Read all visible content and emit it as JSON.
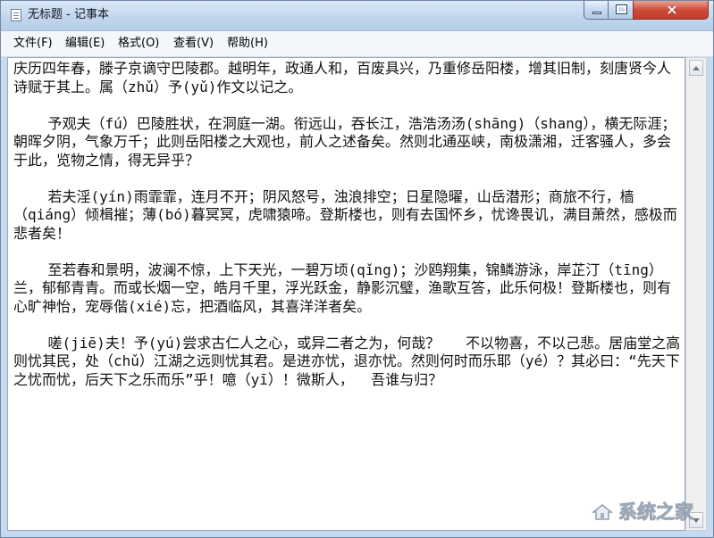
{
  "window": {
    "title": "无标题 - 记事本"
  },
  "menu": {
    "items": [
      "文件(F)",
      "编辑(E)",
      "格式(O)",
      "查看(V)",
      "帮助(H)"
    ]
  },
  "document": {
    "content": "庆历四年春，滕子京谪守巴陵郡。越明年，政通人和，百废具兴，乃重修岳阳楼，增其旧制，刻唐贤今人诗赋于其上。属（zhǔ）予(yǔ)作文以记之。\n\n    予观夫（fú）巴陵胜状，在洞庭一湖。衔远山，吞长江，浩浩汤汤(shāng)（shang），横无际涯；朝晖夕阴，气象万千；此则岳阳楼之大观也，前人之述备矣。然则北通巫峡，南极潇湘，迁客骚人，多会于此，览物之情，得无异乎？\n\n    若夫淫(yín)雨霏霏，连月不开；阴风怒号，浊浪排空；日星隐曜，山岳潜形；商旅不行，樯（qiáng）倾楫摧；薄(bó)暮冥冥，虎啸猿啼。登斯楼也，则有去国怀乡，忧谗畏讥，满目萧然，感极而悲者矣！\n\n    至若春和景明，波澜不惊，上下天光，一碧万顷(qǐng)；沙鸥翔集，锦鳞游泳，岸芷汀（tīng）兰，郁郁青青。而或长烟一空，皓月千里，浮光跃金，静影沉璧，渔歌互答，此乐何极！登斯楼也，则有心旷神怡，宠辱偕(xié)忘，把酒临风，其喜洋洋者矣。\n\n    嗟(jiē)夫！予(yú)尝求古仁人之心，或异二者之为，何哉？   不以物喜，不以己悲。居庙堂之高则忧其民，处（chǔ）江湖之远则忧其君。是进亦忧，退亦忧。然则何时而乐耶（yé）？其必曰：“先天下之忧而忧，后天下之乐而乐”乎！噫（yī）！微斯人，  吾谁与归？"
  },
  "watermark": {
    "text": "系统之家"
  },
  "icons": {
    "app": "notepad-icon",
    "minimize": "minimize-icon",
    "maximize": "maximize-icon",
    "close": "close-icon",
    "scroll_up": "scroll-up-icon",
    "scroll_down": "scroll-down-icon",
    "watermark_logo": "house-logo-icon"
  },
  "colors": {
    "title_bar": "#c7d9ee",
    "menu_bar": "#f3f7fc",
    "close_button": "#cf4d39",
    "editor_background": "#ffffff",
    "text": "#111111"
  }
}
